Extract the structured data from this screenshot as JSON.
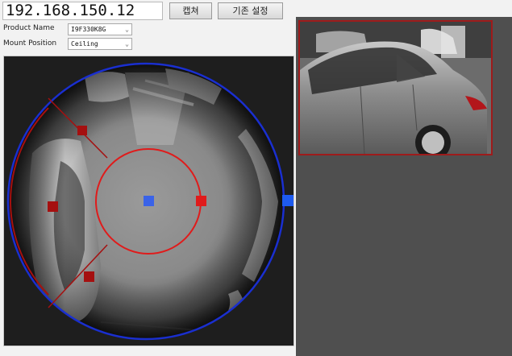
{
  "toolbar": {
    "ip_address": "192.168.150.12",
    "capture_label": "캡쳐",
    "default_settings_label": "기존 설정"
  },
  "settings": {
    "product_name_label": "Product Name",
    "product_name_value": "I9F330K8G",
    "mount_position_label": "Mount Position",
    "mount_position_value": "Ceiling"
  },
  "colors": {
    "roi_circle": "#e01b1b",
    "center_handle": "#3a63e8",
    "edge_handle": "#e01b1b",
    "corner_handle": "#a51010",
    "fisheye_border": "#1a2fd0",
    "zoom_border": "#9e1b1b",
    "panel_bg": "#4f4f4f"
  }
}
